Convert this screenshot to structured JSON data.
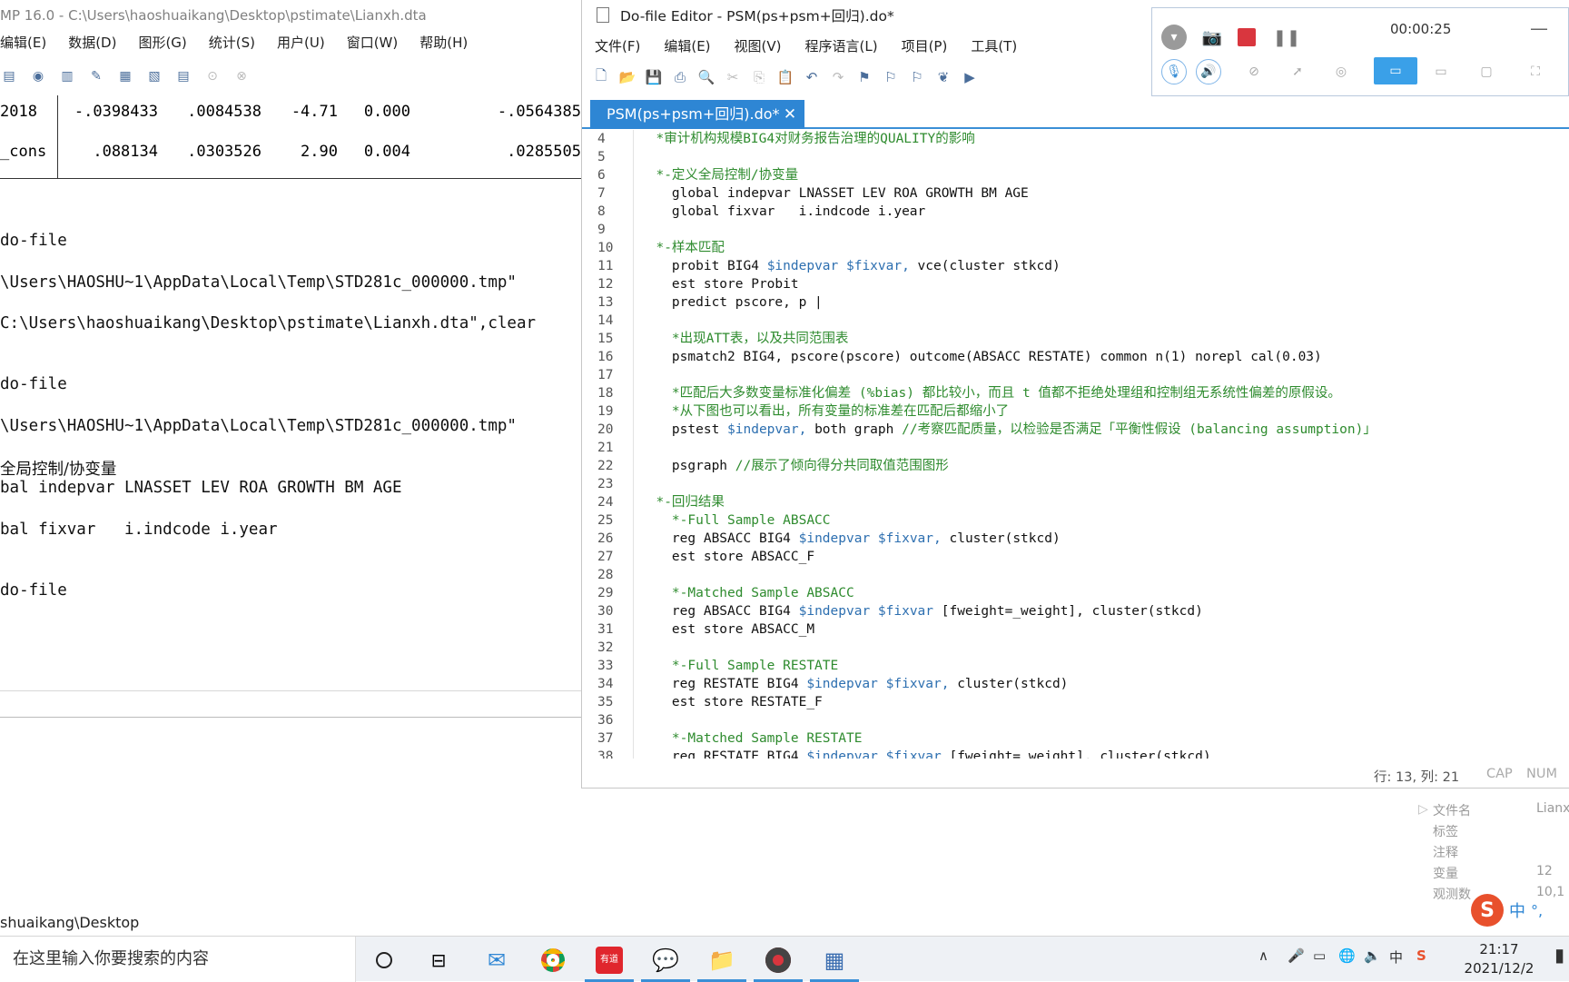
{
  "stata": {
    "title": "MP 16.0 - C:\\Users\\haoshuaikang\\Desktop\\pstimate\\Lianxh.dta",
    "menu": [
      "编辑(E)",
      "数据(D)",
      "图形(G)",
      "统计(S)",
      "用户(U)",
      "窗口(W)",
      "帮助(H)"
    ],
    "results_rows": [
      {
        "label": "2018",
        "coef": "-.0398433",
        "se": ".0084538",
        "t": "-4.71",
        "p": "0.000",
        "ci": "-.0564385"
      },
      {
        "label": "_cons",
        "coef": ".088134",
        "se": ".0303526",
        "t": "2.90",
        "p": "0.004",
        "ci": ".0285505"
      }
    ],
    "log_lines": [
      {
        "text": "do-file",
        "y": 0
      },
      {
        "text": "\\Users\\HAOSHU~1\\AppData\\Local\\Temp\\STD281c_000000.tmp\"",
        "y": 1
      },
      {
        "text": "C:\\Users\\haoshuaikang\\Desktop\\pstimate\\Lianxh.dta\",clear",
        "y": 2
      },
      {
        "text": "do-file",
        "y": 3
      },
      {
        "text": "\\Users\\HAOSHU~1\\AppData\\Local\\Temp\\STD281c_000000.tmp\"",
        "y": 4
      },
      {
        "text": "全局控制/协变量",
        "y": 5
      },
      {
        "text": "bal indepvar LNASSET LEV ROA GROWTH BM AGE",
        "y": 6
      },
      {
        "text": "bal fixvar   i.indcode i.year",
        "y": 7
      },
      {
        "text": "do-file",
        "y": 8
      }
    ],
    "path": "shuaikang\\Desktop",
    "properties": [
      {
        "label": "文件名",
        "value": "Lianx"
      },
      {
        "label": "标签",
        "value": ""
      },
      {
        "label": "注释",
        "value": ""
      },
      {
        "label": "变量",
        "value": "12"
      },
      {
        "label": "观测数",
        "value": "10,1"
      }
    ]
  },
  "editor": {
    "title": "Do-file Editor - PSM(ps+psm+回归).do*",
    "menu": [
      "文件(F)",
      "编辑(E)",
      "视图(V)",
      "程序语言(L)",
      "项目(P)",
      "工具(T)"
    ],
    "tab_label": "PSM(ps+psm+回归).do*",
    "status_position": "行: 13, 列: 21",
    "status_cap": "CAP",
    "status_num": "NUM",
    "code_lines": [
      {
        "n": "4",
        "segs": [
          {
            "t": "  *审计机构规模BIG4对财务报告治理的QUALITY的影响",
            "c": "cm"
          }
        ]
      },
      {
        "n": "5",
        "segs": []
      },
      {
        "n": "6",
        "segs": [
          {
            "t": "  *-定义全局控制/协变量",
            "c": "cm"
          }
        ]
      },
      {
        "n": "7",
        "segs": [
          {
            "t": "    global indepvar LNASSET LEV ROA GROWTH BM AGE",
            "c": "kw"
          }
        ]
      },
      {
        "n": "8",
        "segs": [
          {
            "t": "    global fixvar   i.indcode i.year",
            "c": "kw"
          }
        ]
      },
      {
        "n": "9",
        "segs": []
      },
      {
        "n": "10",
        "segs": [
          {
            "t": "  *-样本匹配",
            "c": "cm"
          }
        ]
      },
      {
        "n": "11",
        "segs": [
          {
            "t": "    probit BIG4 ",
            "c": "kw"
          },
          {
            "t": "$indepvar $fixvar,",
            "c": "mv"
          },
          {
            "t": " vce(cluster stkcd)",
            "c": "kw"
          }
        ]
      },
      {
        "n": "12",
        "segs": [
          {
            "t": "    est store Probit",
            "c": "kw"
          }
        ]
      },
      {
        "n": "13",
        "segs": [
          {
            "t": "    predict pscore, p |",
            "c": "kw"
          }
        ]
      },
      {
        "n": "14",
        "segs": []
      },
      {
        "n": "15",
        "segs": [
          {
            "t": "    *出现ATT表，以及共同范围表",
            "c": "cm"
          }
        ]
      },
      {
        "n": "16",
        "segs": [
          {
            "t": "    psmatch2 BIG4, pscore(pscore) outcome(ABSACC RESTATE) common n(1) norepl cal(0.03)",
            "c": "kw"
          }
        ]
      },
      {
        "n": "17",
        "segs": []
      },
      {
        "n": "18",
        "segs": [
          {
            "t": "    *匹配后大多数变量标准化偏差 (%bias) 都比较小，而且 t 值都不拒绝处理组和控制组无系统性偏差的原假设。",
            "c": "cm"
          }
        ]
      },
      {
        "n": "19",
        "segs": [
          {
            "t": "    *从下图也可以看出，所有变量的标准差在匹配后都缩小了",
            "c": "cm"
          }
        ]
      },
      {
        "n": "20",
        "segs": [
          {
            "t": "    pstest ",
            "c": "kw"
          },
          {
            "t": "$indepvar,",
            "c": "mv"
          },
          {
            "t": " both graph ",
            "c": "kw"
          },
          {
            "t": "//考察匹配质量，以检验是否满足「平衡性假设 (balancing assumption)」",
            "c": "cm"
          }
        ]
      },
      {
        "n": "21",
        "segs": []
      },
      {
        "n": "22",
        "segs": [
          {
            "t": "    psgraph ",
            "c": "kw"
          },
          {
            "t": "//展示了倾向得分共同取值范围图形",
            "c": "cm"
          }
        ]
      },
      {
        "n": "23",
        "segs": []
      },
      {
        "n": "24",
        "segs": [
          {
            "t": "  *-回归结果",
            "c": "cm"
          }
        ]
      },
      {
        "n": "25",
        "segs": [
          {
            "t": "    *-Full Sample ABSACC",
            "c": "cm"
          }
        ]
      },
      {
        "n": "26",
        "segs": [
          {
            "t": "    reg ABSACC BIG4 ",
            "c": "kw"
          },
          {
            "t": "$indepvar $fixvar,",
            "c": "mv"
          },
          {
            "t": " cluster(stkcd)",
            "c": "kw"
          }
        ]
      },
      {
        "n": "27",
        "segs": [
          {
            "t": "    est store ABSACC_F",
            "c": "kw"
          }
        ]
      },
      {
        "n": "28",
        "segs": []
      },
      {
        "n": "29",
        "segs": [
          {
            "t": "    *-Matched Sample ABSACC",
            "c": "cm"
          }
        ]
      },
      {
        "n": "30",
        "segs": [
          {
            "t": "    reg ABSACC BIG4 ",
            "c": "kw"
          },
          {
            "t": "$indepvar $fixvar",
            "c": "mv"
          },
          {
            "t": " [fweight=_weight], cluster(stkcd)",
            "c": "kw"
          }
        ]
      },
      {
        "n": "31",
        "segs": [
          {
            "t": "    est store ABSACC_M",
            "c": "kw"
          }
        ]
      },
      {
        "n": "32",
        "segs": []
      },
      {
        "n": "33",
        "segs": [
          {
            "t": "    *-Full Sample RESTATE",
            "c": "cm"
          }
        ]
      },
      {
        "n": "34",
        "segs": [
          {
            "t": "    reg RESTATE BIG4 ",
            "c": "kw"
          },
          {
            "t": "$indepvar $fixvar,",
            "c": "mv"
          },
          {
            "t": " cluster(stkcd)",
            "c": "kw"
          }
        ]
      },
      {
        "n": "35",
        "segs": [
          {
            "t": "    est store RESTATE_F",
            "c": "kw"
          }
        ]
      },
      {
        "n": "36",
        "segs": []
      },
      {
        "n": "37",
        "segs": [
          {
            "t": "    *-Matched Sample RESTATE",
            "c": "cm"
          }
        ]
      },
      {
        "n": "38",
        "segs": [
          {
            "t": "    reg RESTATE BIG4 ",
            "c": "kw"
          },
          {
            "t": "$indepvar $fixvar",
            "c": "mv"
          },
          {
            "t": " [fweight=_weight], cluster(stkcd)",
            "c": "kw"
          }
        ]
      }
    ]
  },
  "recorder": {
    "time": "00:00:25",
    "minimize": "—"
  },
  "taskbar": {
    "search_placeholder": "在这里输入你要搜索的内容",
    "time": "21:17",
    "date": "2021/12/2",
    "ime": "中"
  },
  "colors": {
    "accent": "#2e86d4",
    "comment": "#2e8b2e",
    "macro": "#2d6fb0",
    "record": "#d9363e"
  }
}
